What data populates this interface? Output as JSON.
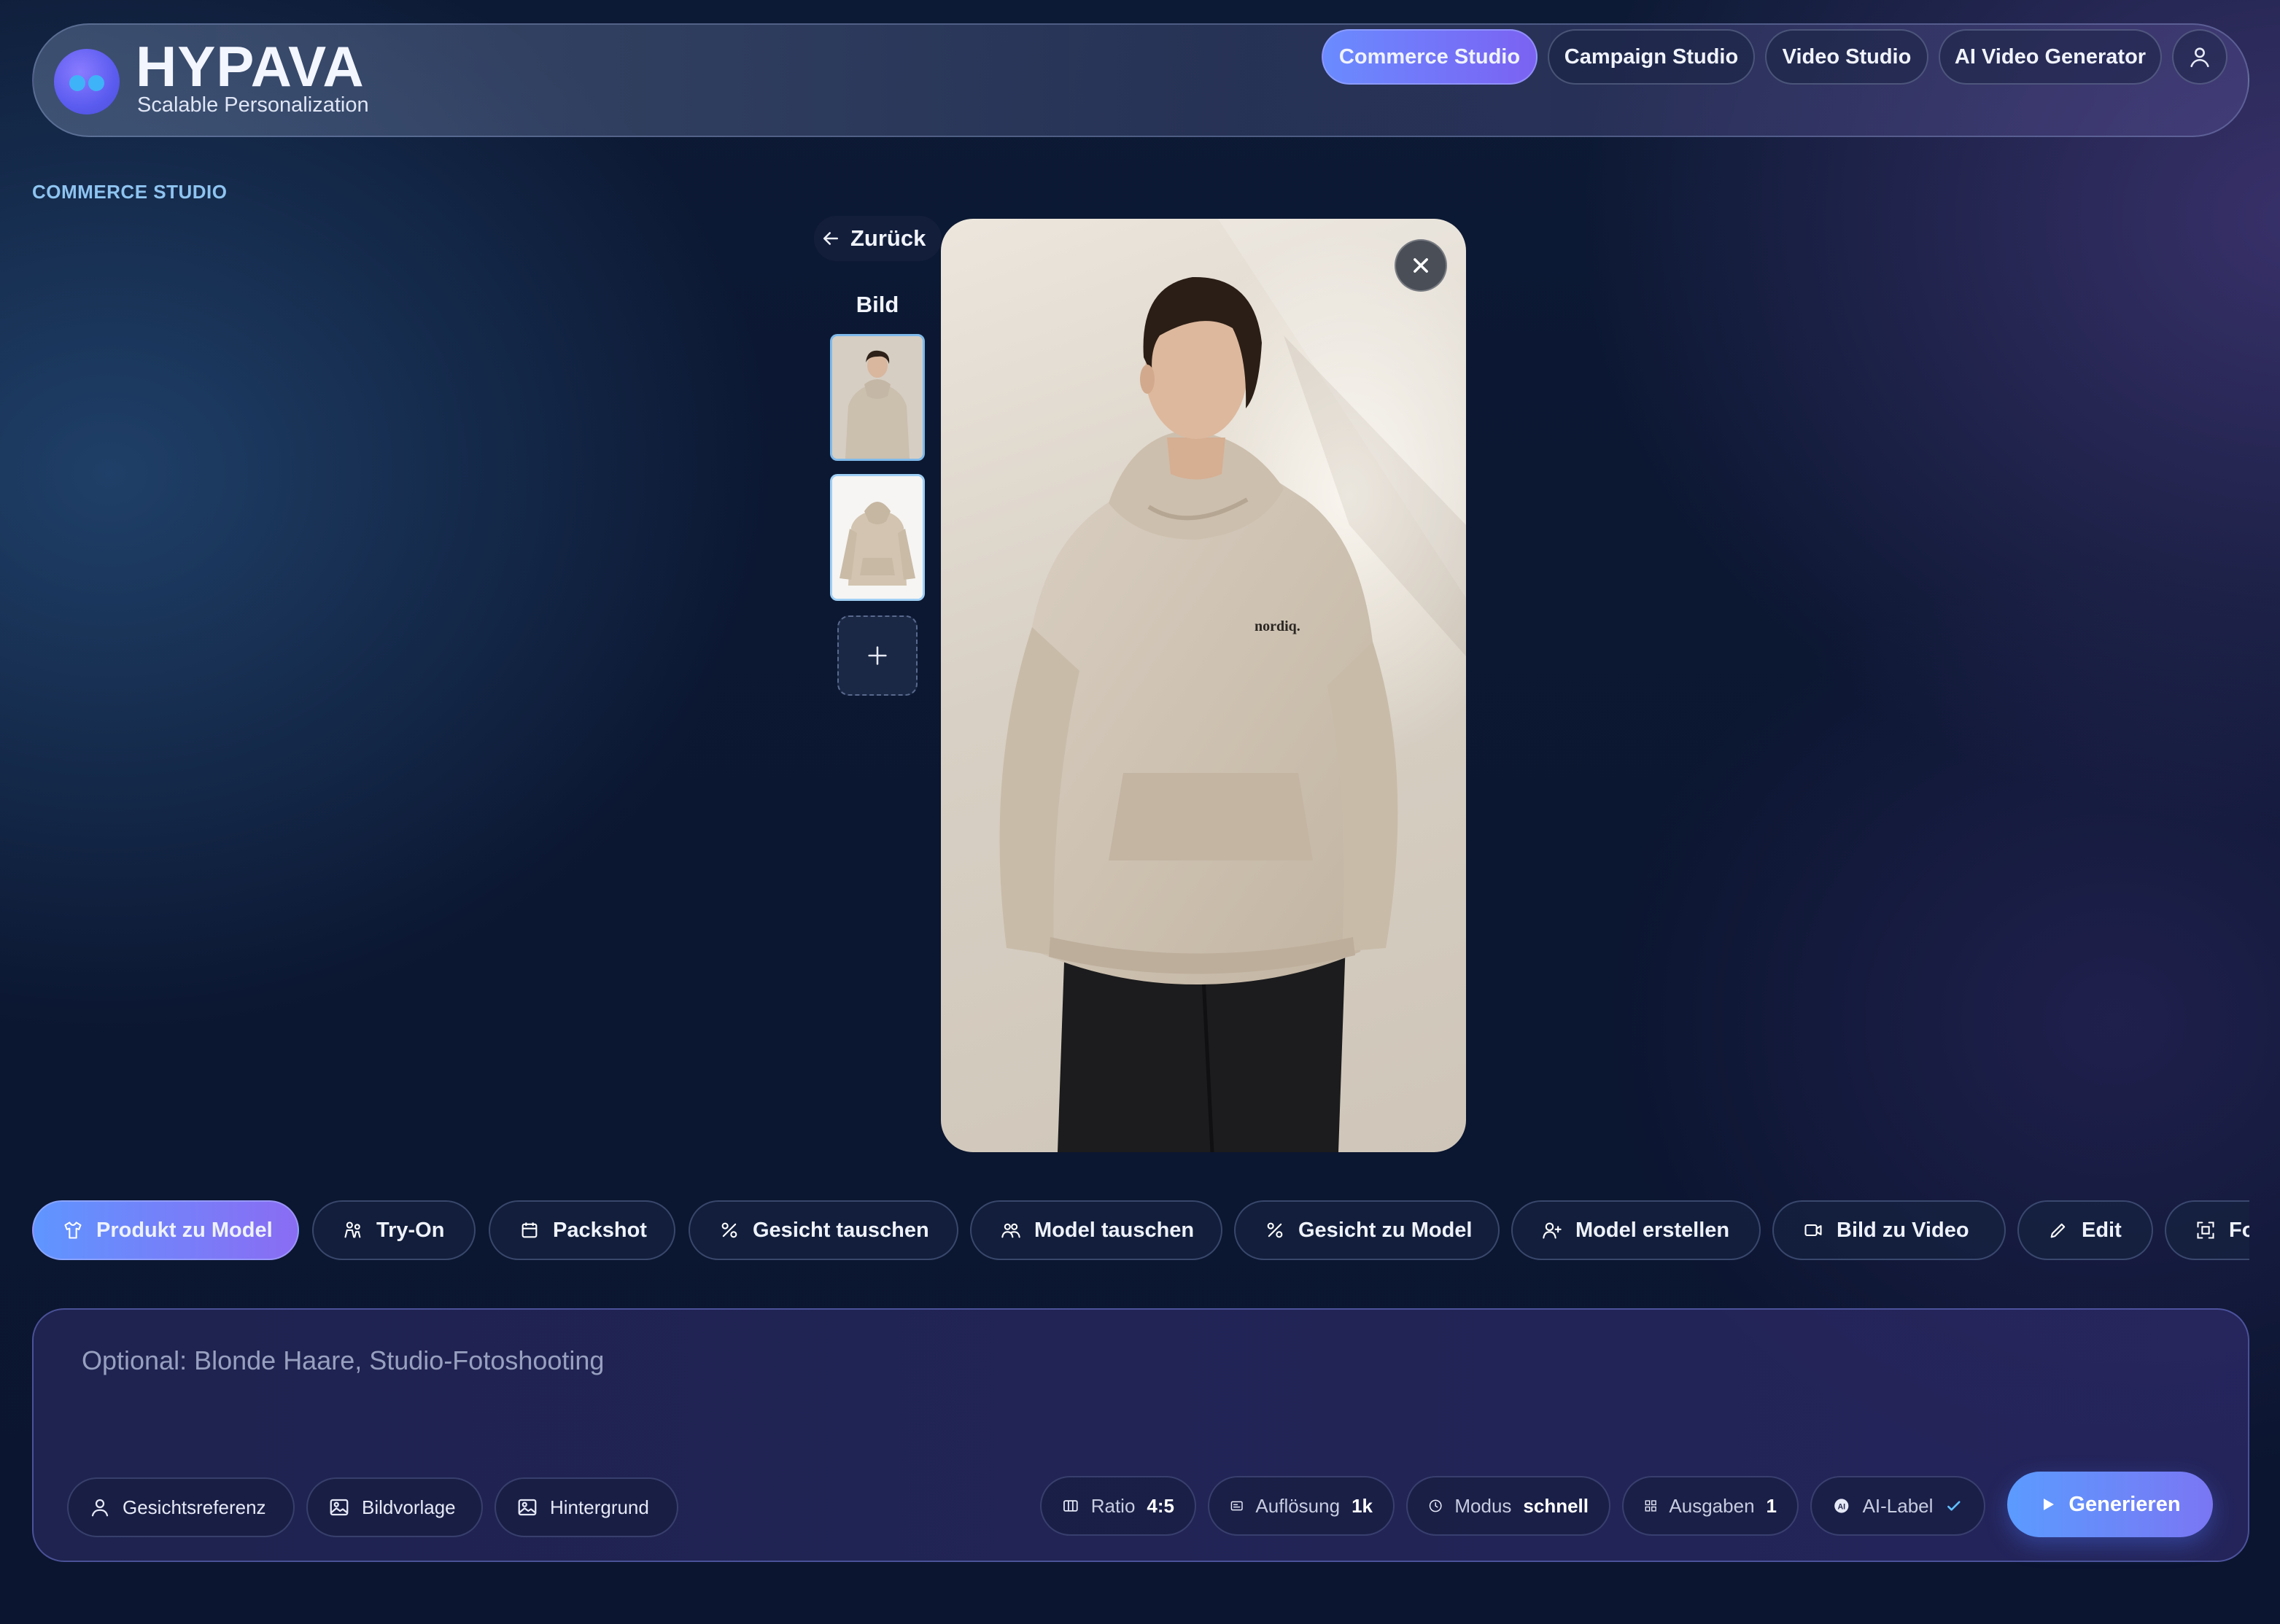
{
  "brand": {
    "name": "HYPAVA",
    "tagline": "Scalable Personalization"
  },
  "nav": {
    "items": [
      {
        "label": "Commerce Studio",
        "active": true
      },
      {
        "label": "Campaign Studio",
        "active": false
      },
      {
        "label": "Video Studio",
        "active": false
      },
      {
        "label": "AI Video Generator",
        "active": false
      }
    ],
    "user_icon": "user-icon"
  },
  "section_label": "COMMERCE STUDIO",
  "gallery": {
    "back_label": "Zurück",
    "title": "Bild",
    "thumbnails": [
      "model-hoodie-thumbnail",
      "hoodie-packshot-thumbnail"
    ],
    "selected_index": 0,
    "add_icon": "plus-icon"
  },
  "preview": {
    "print_text": "nordiq.",
    "close_icon": "close-icon"
  },
  "tools": [
    {
      "label": "Produkt zu Model",
      "icon": "shirt-icon",
      "active": true
    },
    {
      "label": "Try-On",
      "icon": "people-icon",
      "active": false
    },
    {
      "label": "Packshot",
      "icon": "package-icon",
      "active": false
    },
    {
      "label": "Gesicht tauschen",
      "icon": "percent-icon",
      "active": false
    },
    {
      "label": "Model tauschen",
      "icon": "users-icon",
      "active": false
    },
    {
      "label": "Gesicht zu Model",
      "icon": "percent-icon",
      "active": false
    },
    {
      "label": "Model erstellen",
      "icon": "user-plus-icon",
      "active": false
    },
    {
      "label": "Bild zu Video",
      "icon": "video-icon",
      "active": false
    },
    {
      "label": "Edit",
      "icon": "pencil-icon",
      "active": false
    },
    {
      "label": "Format",
      "icon": "frame-icon",
      "active": false
    }
  ],
  "prompt": {
    "placeholder": "Optional: Blonde Haare, Studio-Fotoshooting",
    "value": ""
  },
  "references": [
    {
      "label": "Gesichtsreferenz",
      "icon": "user-icon"
    },
    {
      "label": "Bildvorlage",
      "icon": "image-icon"
    },
    {
      "label": "Hintergrund",
      "icon": "image-icon"
    }
  ],
  "settings": {
    "ratio": {
      "label": "Ratio",
      "value": "4:5"
    },
    "resolution": {
      "label": "Auflösung",
      "value": "1k"
    },
    "mode": {
      "label": "Modus",
      "value": "schnell"
    },
    "outputs": {
      "label": "Ausgaben",
      "value": "1"
    },
    "ai_label": {
      "label": "AI-Label",
      "checked": true
    }
  },
  "generate_label": "Generieren",
  "colors": {
    "accent_start": "#5b9bff",
    "accent_end": "#7a76f3",
    "section_label": "#8ec4f0"
  }
}
